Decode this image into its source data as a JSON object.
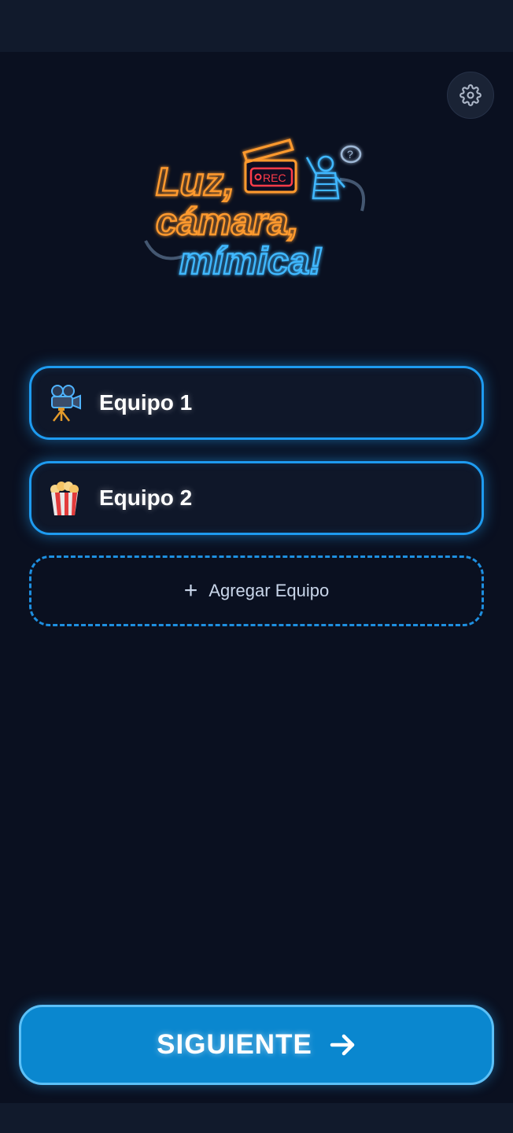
{
  "header": {
    "settings_icon": "gear-icon"
  },
  "logo": {
    "line1": "Luz,",
    "line2": "cámara,",
    "line3": "mímica!",
    "rec_label": "REC",
    "bubble_label": "?",
    "colors": {
      "orange": "#ff9a2e",
      "blue": "#3fb8ff",
      "red": "#ff3b4a"
    }
  },
  "teams": [
    {
      "name": "Equipo 1",
      "icon": "movie-camera-icon"
    },
    {
      "name": "Equipo 2",
      "icon": "popcorn-icon"
    }
  ],
  "add_team": {
    "label": "Agregar Equipo",
    "icon": "plus-icon"
  },
  "next_button": {
    "label": "SIGUIENTE",
    "icon": "arrow-right-icon"
  },
  "colors": {
    "background": "#0a1020",
    "accent": "#1e9bf0",
    "button": "#0a87cf"
  }
}
